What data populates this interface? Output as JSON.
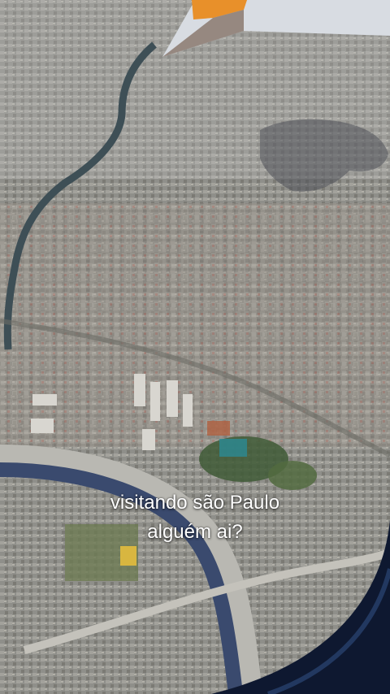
{
  "story": {
    "caption_line1": "visitando são Paulo",
    "caption_line2": "alguém ai?"
  },
  "colors": {
    "city": "#8a8a86",
    "river": "#3e4f56",
    "water_channel": "#3a4a6e",
    "wing_orange": "#e8902a",
    "wing_body": "#d8dce2",
    "window_frame": "#0e1830",
    "caption_text": "#ffffff"
  }
}
